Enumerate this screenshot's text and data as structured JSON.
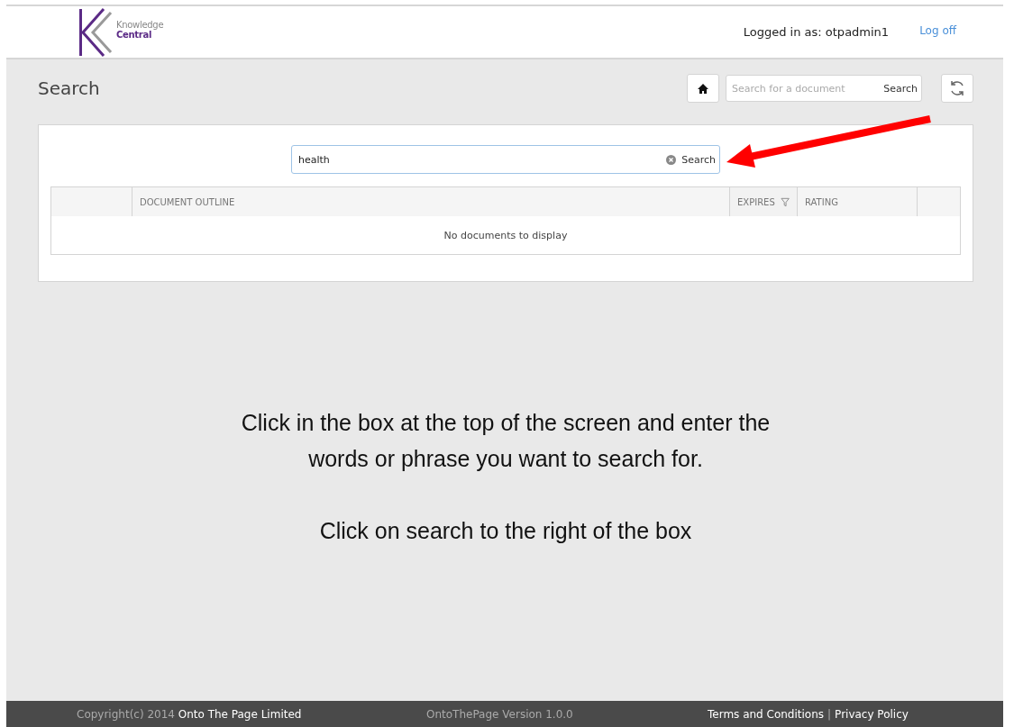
{
  "header": {
    "logo_lines": [
      "Knowledge",
      "Central"
    ],
    "user_label": "Logged in as: otpadmin1",
    "logoff_link": "Log off"
  },
  "page": {
    "title": "Search",
    "doc_search": {
      "placeholder": "Search for a document",
      "button": "Search"
    }
  },
  "search": {
    "value": "health",
    "button": "Search"
  },
  "table": {
    "columns": [
      {
        "label": "DOCUMENT OUTLINE",
        "filter": false
      },
      {
        "label": "EXPIRES",
        "filter": true
      },
      {
        "label": "RATING",
        "filter": false
      }
    ],
    "empty_message": "No documents to display"
  },
  "instructions": [
    "Click in the box at the top of the screen and enter the words or phrase you want to search for.",
    "Click on search to the right of the box"
  ],
  "footer": {
    "copyright": "Copyright(c) 2014 **Onto The Page Limited**",
    "version": "OntoThePage Version 1.0.0",
    "terms": "Terms and Conditions",
    "separator": "|",
    "privacy": "Privacy Policy"
  }
}
